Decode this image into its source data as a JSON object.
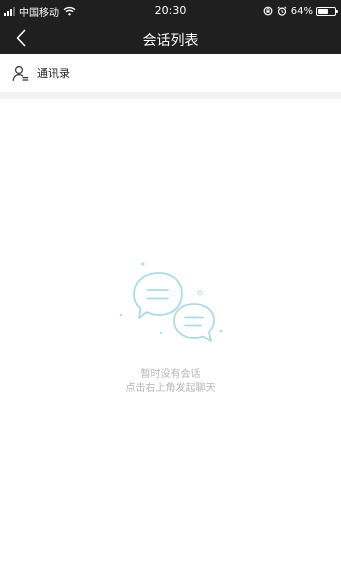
{
  "status_bar": {
    "carrier": "中国移动",
    "time": "20:30",
    "battery_percent": "64%",
    "battery_level": 0.64,
    "icons": [
      "signal-icon",
      "wifi-icon",
      "rotation-lock-icon",
      "alarm-icon",
      "battery-icon"
    ]
  },
  "nav": {
    "title": "会话列表",
    "back_icon": "chevron-left-icon"
  },
  "contacts": {
    "label": "通讯录",
    "icon": "contacts-icon"
  },
  "empty_state": {
    "illustration": "chat-bubbles-icon",
    "title": "暂时没有会话",
    "hint": "点击右上角发起聊天",
    "accent_color": "#a8dde8"
  },
  "colors": {
    "header_background": "#1f1f1f",
    "divider": "#f2f2f4",
    "empty_text": "#b5b5b5"
  }
}
